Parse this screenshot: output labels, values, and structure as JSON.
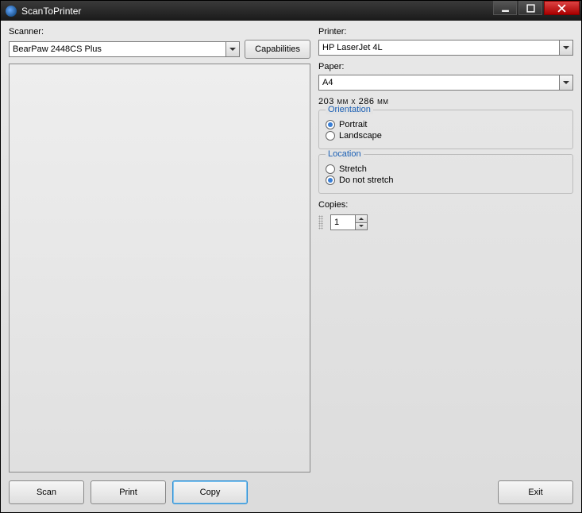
{
  "window": {
    "title": "ScanToPrinter"
  },
  "scanner": {
    "label": "Scanner:",
    "selected": "BearPaw 2448CS Plus",
    "capabilities_label": "Capabilities"
  },
  "printer": {
    "label": "Printer:",
    "selected": "HP LaserJet 4L"
  },
  "paper": {
    "label": "Paper:",
    "selected": "A4",
    "dimensions": "203 мм x 286 мм"
  },
  "orientation": {
    "legend": "Orientation",
    "portrait": "Portrait",
    "landscape": "Landscape",
    "selected": "portrait"
  },
  "location": {
    "legend": "Location",
    "stretch": "Stretch",
    "do_not_stretch": "Do not stretch",
    "selected": "do_not_stretch"
  },
  "copies": {
    "label": "Copies:",
    "value": "1"
  },
  "footer": {
    "scan": "Scan",
    "print": "Print",
    "copy": "Copy",
    "exit": "Exit"
  }
}
